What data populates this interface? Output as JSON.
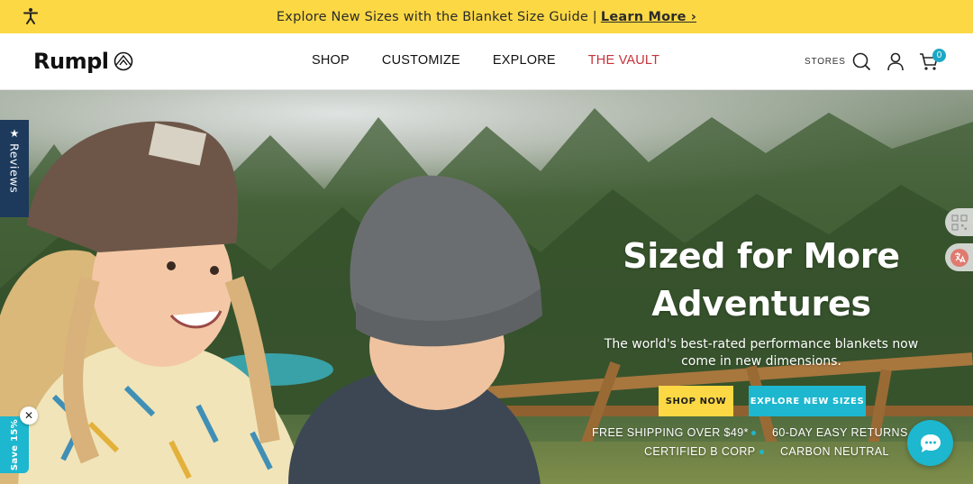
{
  "announcement": {
    "text": "Explore New Sizes with the Blanket Size Guide |",
    "link": "Learn More ›"
  },
  "header": {
    "logo": "Rumpl",
    "nav": [
      "SHOP",
      "CUSTOMIZE",
      "EXPLORE",
      "THE VAULT"
    ],
    "stores_label": "STORES",
    "cart_count": "0"
  },
  "hero": {
    "title_line1": "Sized for More",
    "title_line2": "Adventures",
    "subtitle_line1": "The world's best-rated performance blankets now",
    "subtitle_line2": "come in new dimensions.",
    "shop_button": "SHOP NOW",
    "explore_button": "EXPLORE NEW SIZES",
    "perks": [
      "FREE SHIPPING OVER $49*",
      "60-DAY EASY RETURNS",
      "CERTIFIED B CORP",
      "CARBON NEUTRAL"
    ]
  },
  "widgets": {
    "reviews_label": "Reviews",
    "save_label": "Save 15%",
    "close_symbol": "✕"
  },
  "colors": {
    "announcement_bg": "#fcd844",
    "accent_teal": "#1db7cf",
    "vault_red": "#c8323a",
    "reviews_navy": "#1d3a5c"
  }
}
